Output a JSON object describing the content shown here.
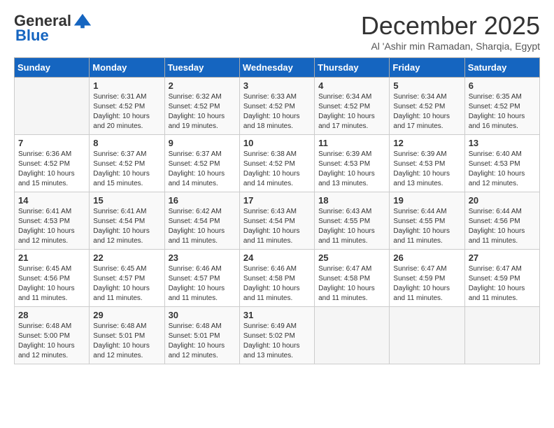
{
  "header": {
    "logo_general": "General",
    "logo_blue": "Blue",
    "month_title": "December 2025",
    "location": "Al 'Ashir min Ramadan, Sharqia, Egypt"
  },
  "days_of_week": [
    "Sunday",
    "Monday",
    "Tuesday",
    "Wednesday",
    "Thursday",
    "Friday",
    "Saturday"
  ],
  "weeks": [
    [
      {
        "day": "",
        "sunrise": "",
        "sunset": "",
        "daylight": ""
      },
      {
        "day": "1",
        "sunrise": "Sunrise: 6:31 AM",
        "sunset": "Sunset: 4:52 PM",
        "daylight": "Daylight: 10 hours and 20 minutes."
      },
      {
        "day": "2",
        "sunrise": "Sunrise: 6:32 AM",
        "sunset": "Sunset: 4:52 PM",
        "daylight": "Daylight: 10 hours and 19 minutes."
      },
      {
        "day": "3",
        "sunrise": "Sunrise: 6:33 AM",
        "sunset": "Sunset: 4:52 PM",
        "daylight": "Daylight: 10 hours and 18 minutes."
      },
      {
        "day": "4",
        "sunrise": "Sunrise: 6:34 AM",
        "sunset": "Sunset: 4:52 PM",
        "daylight": "Daylight: 10 hours and 17 minutes."
      },
      {
        "day": "5",
        "sunrise": "Sunrise: 6:34 AM",
        "sunset": "Sunset: 4:52 PM",
        "daylight": "Daylight: 10 hours and 17 minutes."
      },
      {
        "day": "6",
        "sunrise": "Sunrise: 6:35 AM",
        "sunset": "Sunset: 4:52 PM",
        "daylight": "Daylight: 10 hours and 16 minutes."
      }
    ],
    [
      {
        "day": "7",
        "sunrise": "Sunrise: 6:36 AM",
        "sunset": "Sunset: 4:52 PM",
        "daylight": "Daylight: 10 hours and 15 minutes."
      },
      {
        "day": "8",
        "sunrise": "Sunrise: 6:37 AM",
        "sunset": "Sunset: 4:52 PM",
        "daylight": "Daylight: 10 hours and 15 minutes."
      },
      {
        "day": "9",
        "sunrise": "Sunrise: 6:37 AM",
        "sunset": "Sunset: 4:52 PM",
        "daylight": "Daylight: 10 hours and 14 minutes."
      },
      {
        "day": "10",
        "sunrise": "Sunrise: 6:38 AM",
        "sunset": "Sunset: 4:52 PM",
        "daylight": "Daylight: 10 hours and 14 minutes."
      },
      {
        "day": "11",
        "sunrise": "Sunrise: 6:39 AM",
        "sunset": "Sunset: 4:53 PM",
        "daylight": "Daylight: 10 hours and 13 minutes."
      },
      {
        "day": "12",
        "sunrise": "Sunrise: 6:39 AM",
        "sunset": "Sunset: 4:53 PM",
        "daylight": "Daylight: 10 hours and 13 minutes."
      },
      {
        "day": "13",
        "sunrise": "Sunrise: 6:40 AM",
        "sunset": "Sunset: 4:53 PM",
        "daylight": "Daylight: 10 hours and 12 minutes."
      }
    ],
    [
      {
        "day": "14",
        "sunrise": "Sunrise: 6:41 AM",
        "sunset": "Sunset: 4:53 PM",
        "daylight": "Daylight: 10 hours and 12 minutes."
      },
      {
        "day": "15",
        "sunrise": "Sunrise: 6:41 AM",
        "sunset": "Sunset: 4:54 PM",
        "daylight": "Daylight: 10 hours and 12 minutes."
      },
      {
        "day": "16",
        "sunrise": "Sunrise: 6:42 AM",
        "sunset": "Sunset: 4:54 PM",
        "daylight": "Daylight: 10 hours and 11 minutes."
      },
      {
        "day": "17",
        "sunrise": "Sunrise: 6:43 AM",
        "sunset": "Sunset: 4:54 PM",
        "daylight": "Daylight: 10 hours and 11 minutes."
      },
      {
        "day": "18",
        "sunrise": "Sunrise: 6:43 AM",
        "sunset": "Sunset: 4:55 PM",
        "daylight": "Daylight: 10 hours and 11 minutes."
      },
      {
        "day": "19",
        "sunrise": "Sunrise: 6:44 AM",
        "sunset": "Sunset: 4:55 PM",
        "daylight": "Daylight: 10 hours and 11 minutes."
      },
      {
        "day": "20",
        "sunrise": "Sunrise: 6:44 AM",
        "sunset": "Sunset: 4:56 PM",
        "daylight": "Daylight: 10 hours and 11 minutes."
      }
    ],
    [
      {
        "day": "21",
        "sunrise": "Sunrise: 6:45 AM",
        "sunset": "Sunset: 4:56 PM",
        "daylight": "Daylight: 10 hours and 11 minutes."
      },
      {
        "day": "22",
        "sunrise": "Sunrise: 6:45 AM",
        "sunset": "Sunset: 4:57 PM",
        "daylight": "Daylight: 10 hours and 11 minutes."
      },
      {
        "day": "23",
        "sunrise": "Sunrise: 6:46 AM",
        "sunset": "Sunset: 4:57 PM",
        "daylight": "Daylight: 10 hours and 11 minutes."
      },
      {
        "day": "24",
        "sunrise": "Sunrise: 6:46 AM",
        "sunset": "Sunset: 4:58 PM",
        "daylight": "Daylight: 10 hours and 11 minutes."
      },
      {
        "day": "25",
        "sunrise": "Sunrise: 6:47 AM",
        "sunset": "Sunset: 4:58 PM",
        "daylight": "Daylight: 10 hours and 11 minutes."
      },
      {
        "day": "26",
        "sunrise": "Sunrise: 6:47 AM",
        "sunset": "Sunset: 4:59 PM",
        "daylight": "Daylight: 10 hours and 11 minutes."
      },
      {
        "day": "27",
        "sunrise": "Sunrise: 6:47 AM",
        "sunset": "Sunset: 4:59 PM",
        "daylight": "Daylight: 10 hours and 11 minutes."
      }
    ],
    [
      {
        "day": "28",
        "sunrise": "Sunrise: 6:48 AM",
        "sunset": "Sunset: 5:00 PM",
        "daylight": "Daylight: 10 hours and 12 minutes."
      },
      {
        "day": "29",
        "sunrise": "Sunrise: 6:48 AM",
        "sunset": "Sunset: 5:01 PM",
        "daylight": "Daylight: 10 hours and 12 minutes."
      },
      {
        "day": "30",
        "sunrise": "Sunrise: 6:48 AM",
        "sunset": "Sunset: 5:01 PM",
        "daylight": "Daylight: 10 hours and 12 minutes."
      },
      {
        "day": "31",
        "sunrise": "Sunrise: 6:49 AM",
        "sunset": "Sunset: 5:02 PM",
        "daylight": "Daylight: 10 hours and 13 minutes."
      },
      {
        "day": "",
        "sunrise": "",
        "sunset": "",
        "daylight": ""
      },
      {
        "day": "",
        "sunrise": "",
        "sunset": "",
        "daylight": ""
      },
      {
        "day": "",
        "sunrise": "",
        "sunset": "",
        "daylight": ""
      }
    ]
  ]
}
